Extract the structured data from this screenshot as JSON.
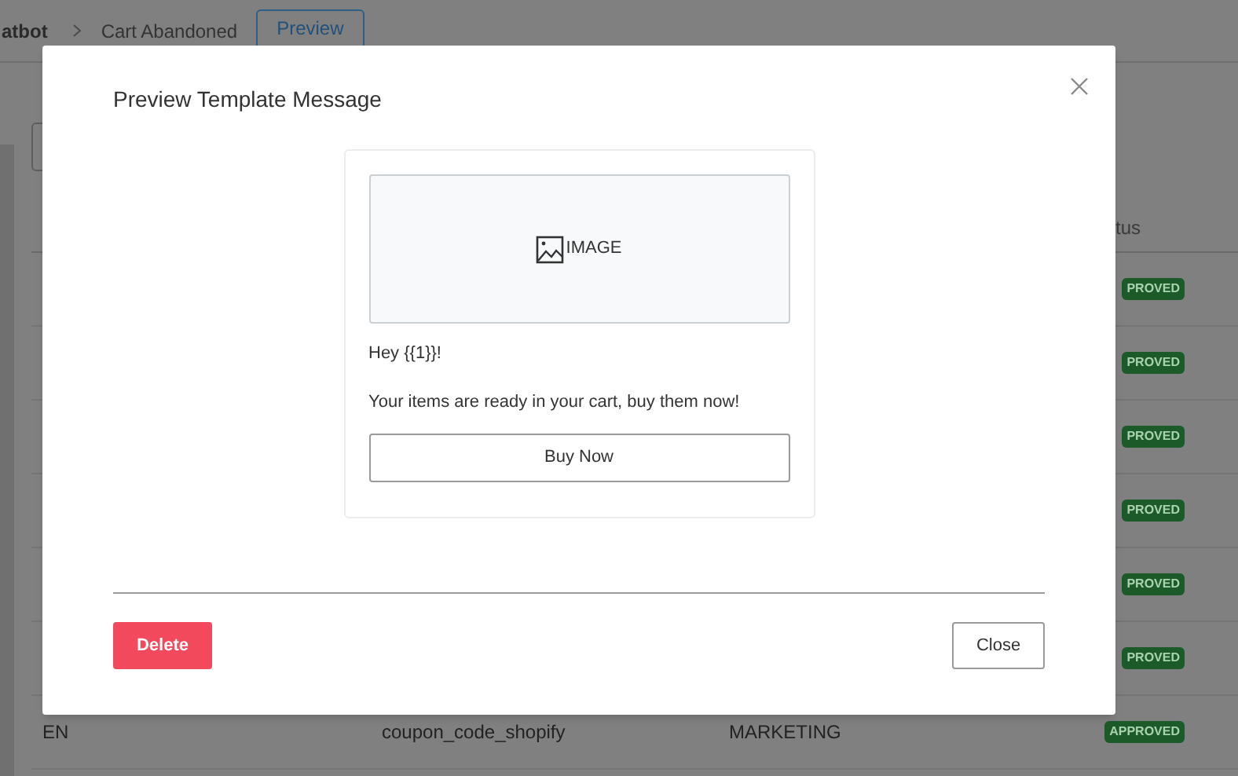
{
  "breadcrumb": {
    "items": [
      {
        "label": "atbot"
      },
      {
        "label": "Cart Abandoned"
      }
    ],
    "tab": {
      "label": "Preview",
      "selected": true
    }
  },
  "table": {
    "status_header": "tus",
    "rows": [
      {
        "status": "PROVED"
      },
      {
        "status": "PROVED"
      },
      {
        "status": "PROVED"
      },
      {
        "status": "PROVED"
      },
      {
        "status": "PROVED"
      },
      {
        "status": "PROVED"
      },
      {
        "language": "EN",
        "name": "coupon_code_shopify",
        "category": "MARKETING",
        "status": "APPROVED"
      }
    ]
  },
  "modal": {
    "title": "Preview Template Message",
    "preview": {
      "media_label": "IMAGE",
      "lines": [
        "Hey {{1}}!",
        "Your items are ready in your cart, buy them now!"
      ],
      "button": "Buy Now"
    },
    "actions": {
      "delete": "Delete",
      "close": "Close"
    }
  }
}
